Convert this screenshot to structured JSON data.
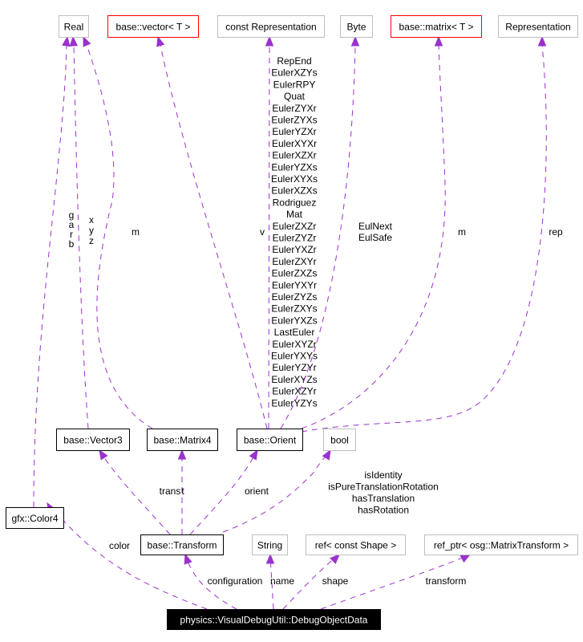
{
  "diagram": {
    "edge_color": "#9a32cd",
    "nodes": [
      {
        "id": "real",
        "label": "Real",
        "style": "gray"
      },
      {
        "id": "vector",
        "label": "base::vector< T >",
        "style": "red"
      },
      {
        "id": "constrep",
        "label": "const Representation",
        "style": "gray"
      },
      {
        "id": "byte",
        "label": "Byte",
        "style": "gray"
      },
      {
        "id": "matrix",
        "label": "base::matrix< T >",
        "style": "red"
      },
      {
        "id": "rep",
        "label": "Representation",
        "style": "gray"
      },
      {
        "id": "vector3",
        "label": "base::Vector3",
        "style": "black"
      },
      {
        "id": "matrix4",
        "label": "base::Matrix4",
        "style": "black"
      },
      {
        "id": "orient",
        "label": "base::Orient",
        "style": "black"
      },
      {
        "id": "bool",
        "label": "bool",
        "style": "gray"
      },
      {
        "id": "color4",
        "label": "gfx::Color4",
        "style": "black"
      },
      {
        "id": "transform",
        "label": "base::Transform",
        "style": "black"
      },
      {
        "id": "string",
        "label": "String",
        "style": "gray"
      },
      {
        "id": "refshape",
        "label": "ref< const Shape >",
        "style": "gray"
      },
      {
        "id": "refptr",
        "label": "ref_ptr< osg::MatrixTransform >",
        "style": "gray"
      },
      {
        "id": "main",
        "label": "physics::VisualDebugUtil::DebugObjectData",
        "style": "main"
      }
    ],
    "edges": [
      {
        "from": "color4",
        "to": "real",
        "labels": [
          "g",
          "a",
          "r",
          "b"
        ]
      },
      {
        "from": "vector3",
        "to": "real",
        "labels": [
          "x",
          "y",
          "z"
        ]
      },
      {
        "from": "matrix4",
        "to": "real",
        "labels": [
          "m"
        ]
      },
      {
        "from": "orient",
        "to": "vector",
        "labels": [
          "v"
        ]
      },
      {
        "from": "orient",
        "to": "constrep",
        "labels": [
          "RepEnd",
          "EulerXZYs",
          "EulerRPY",
          "Quat",
          "EulerZYXr",
          "EulerZYXs",
          "EulerYZXr",
          "EulerXYXr",
          "EulerXZXr",
          "EulerYZXs",
          "EulerXYXs",
          "EulerXZXs",
          "Rodriguez",
          "Mat",
          "EulerZXZr",
          "EulerZYZr",
          "EulerYXZr",
          "EulerZXYr",
          "EulerZXZs",
          "EulerYXYr",
          "EulerZYZs",
          "EulerZXYs",
          "EulerYXZs",
          "LastEuler",
          "EulerXYZr",
          "EulerYXYs",
          "EulerYZYr",
          "EulerXYZs",
          "EulerXZYr",
          "EulerYZYs"
        ]
      },
      {
        "from": "orient",
        "to": "byte",
        "labels": [
          "EulNext",
          "EulSafe"
        ]
      },
      {
        "from": "orient",
        "to": "matrix",
        "labels": [
          "m"
        ]
      },
      {
        "from": "orient",
        "to": "rep",
        "labels": [
          "rep"
        ]
      },
      {
        "from": "transform",
        "to": "vector3",
        "labels": [
          "trans"
        ]
      },
      {
        "from": "transform",
        "to": "matrix4",
        "labels": [
          "t"
        ]
      },
      {
        "from": "transform",
        "to": "orient",
        "labels": [
          "orient"
        ]
      },
      {
        "from": "transform",
        "to": "bool",
        "labels": [
          "isIdentity",
          "isPureTranslationRotation",
          "hasTranslation",
          "hasRotation"
        ]
      },
      {
        "from": "main",
        "to": "color4",
        "labels": [
          "color"
        ]
      },
      {
        "from": "main",
        "to": "transform",
        "labels": [
          "configuration"
        ]
      },
      {
        "from": "main",
        "to": "string",
        "labels": [
          "name"
        ]
      },
      {
        "from": "main",
        "to": "refshape",
        "labels": [
          "shape"
        ]
      },
      {
        "from": "main",
        "to": "refptr",
        "labels": [
          "transform"
        ]
      }
    ]
  }
}
